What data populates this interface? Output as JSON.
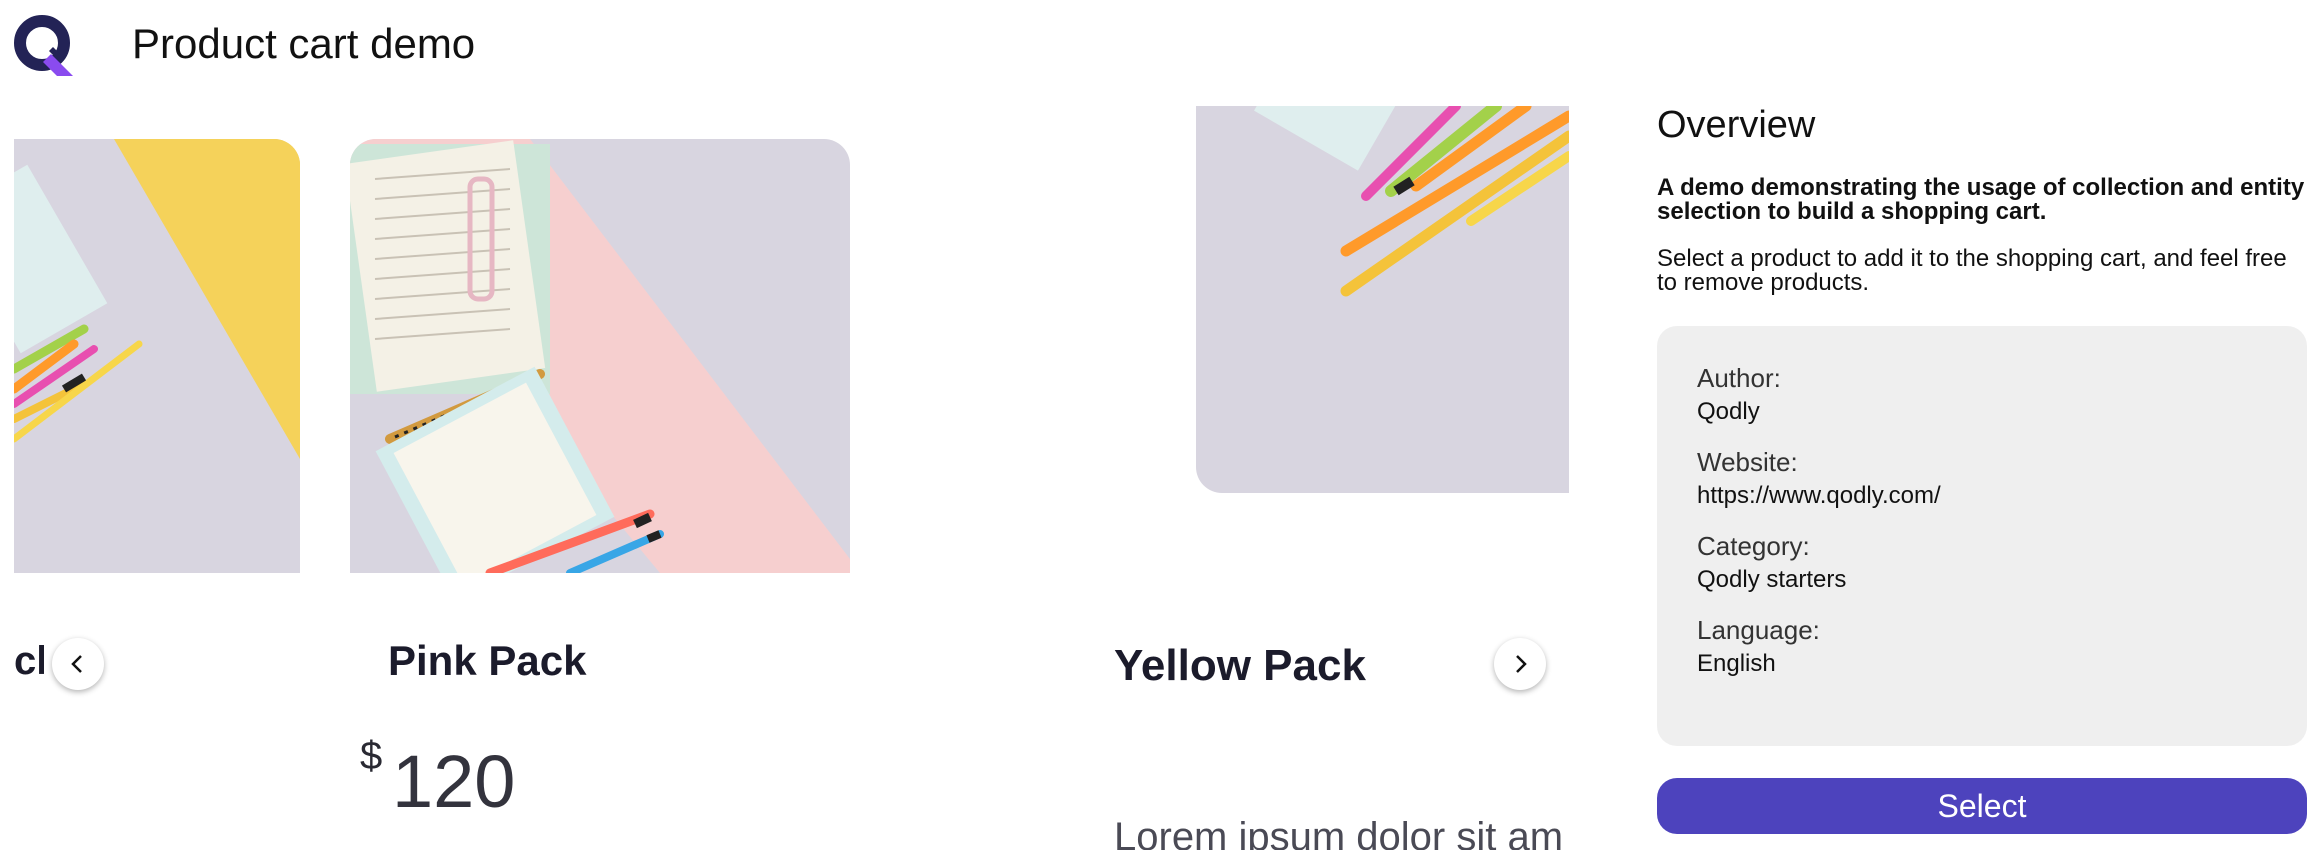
{
  "header": {
    "title": "Product cart demo",
    "logo_icon": "qodly-logo-icon"
  },
  "carousel": {
    "partial_item": {
      "name": "cl"
    },
    "items": [
      {
        "name": "Pink Pack",
        "currency": "$",
        "price": "120"
      },
      {
        "name": "Yellow Pack",
        "description": "Lorem ipsum dolor sit am"
      }
    ],
    "prev_icon": "chevron-left-icon",
    "next_icon": "chevron-right-icon"
  },
  "overview": {
    "title": "Overview",
    "description": "A demo demonstrating the usage of collection and entity selection to build a shopping cart.",
    "text": "Select a product to add it to the shopping cart, and feel free to remove products.",
    "details": [
      {
        "label": "Author:",
        "value": "Qodly"
      },
      {
        "label": "Website:",
        "value": "https://www.qodly.com/"
      },
      {
        "label": "Category:",
        "value": "Qodly starters"
      },
      {
        "label": "Language:",
        "value": "English"
      }
    ],
    "select_label": "Select"
  },
  "colors": {
    "accent": "#4d43bd",
    "logo_dark": "#232356",
    "logo_purple": "#8a4bef",
    "info_bg": "#efefef",
    "yellow": "#f5d25a",
    "lavender": "#d8d5e0",
    "pink": "#f6cfcf"
  }
}
